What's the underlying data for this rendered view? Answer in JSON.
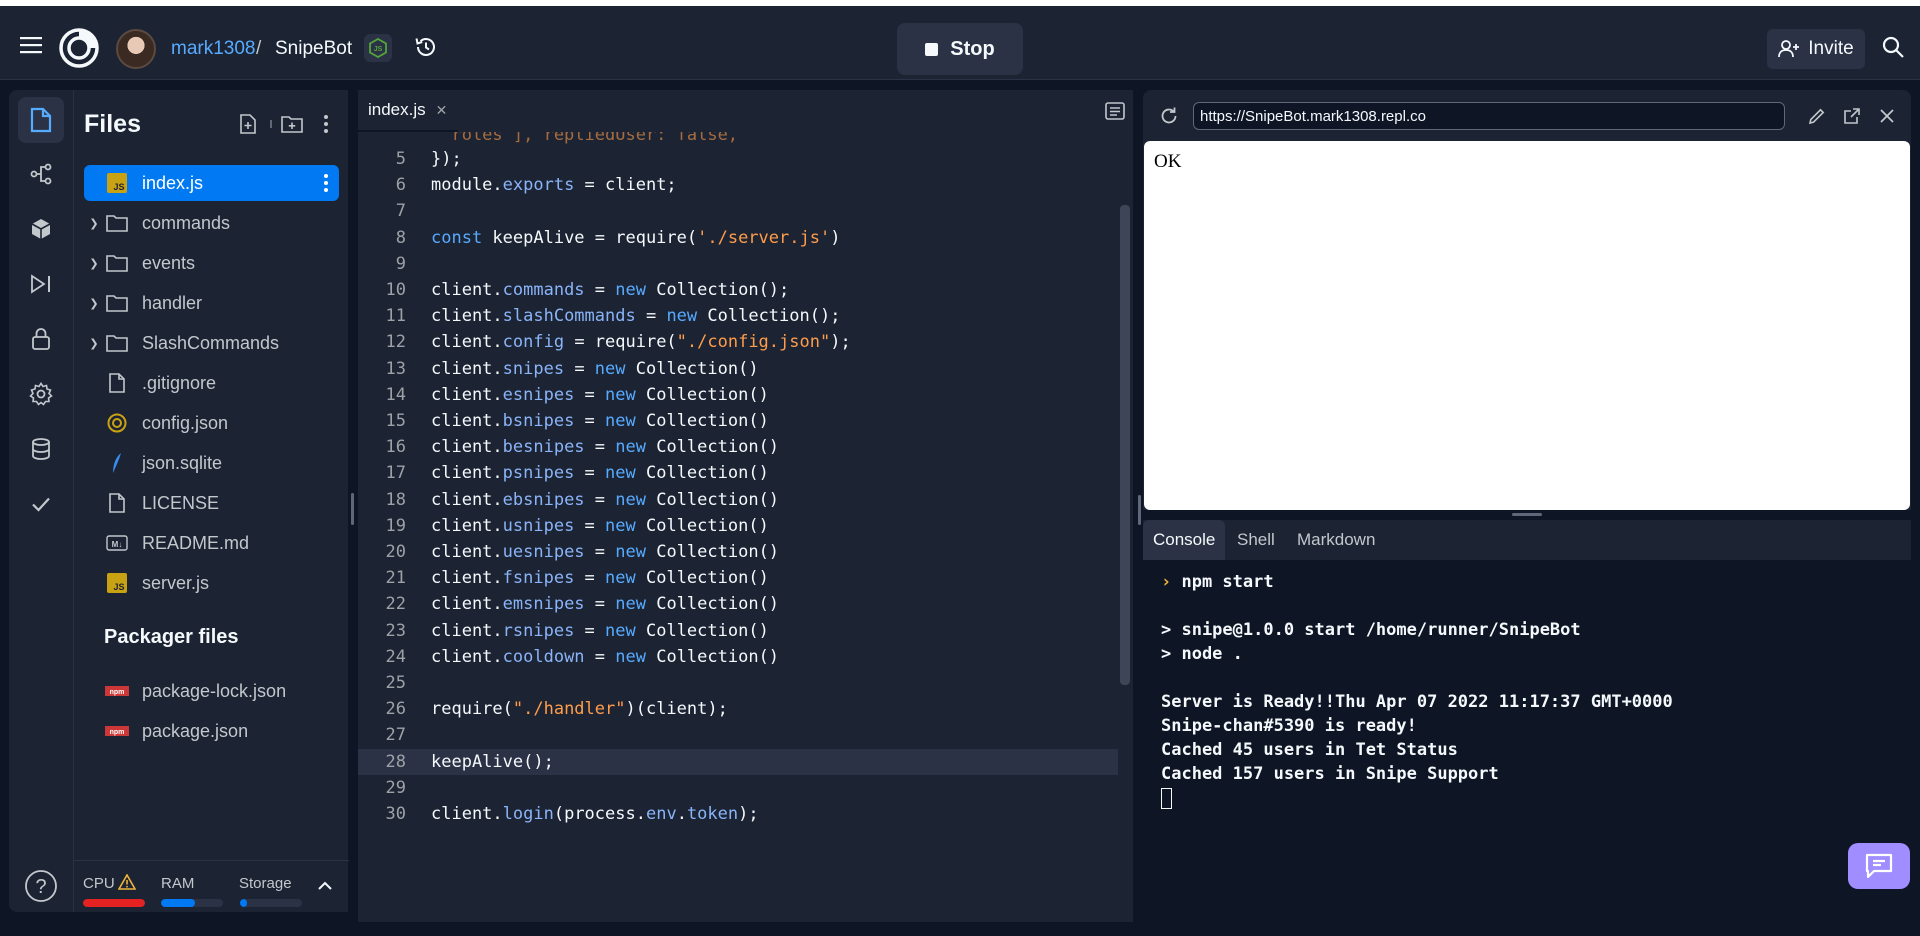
{
  "topbar": {
    "username": "mark1308",
    "separator": "/",
    "repl_name": "SnipeBot",
    "stop_label": "Stop",
    "invite_label": "Invite"
  },
  "files": {
    "title": "Files",
    "items": [
      {
        "label": "index.js",
        "icon": "js-file-icon",
        "type": "file",
        "active": true
      },
      {
        "label": "commands",
        "icon": "folder-icon",
        "type": "folder"
      },
      {
        "label": "events",
        "icon": "folder-icon",
        "type": "folder"
      },
      {
        "label": "handler",
        "icon": "folder-icon",
        "type": "folder"
      },
      {
        "label": "SlashCommands",
        "icon": "folder-icon",
        "type": "folder"
      },
      {
        "label": ".gitignore",
        "icon": "file-icon",
        "type": "file"
      },
      {
        "label": "config.json",
        "icon": "json-file-icon",
        "type": "file"
      },
      {
        "label": "json.sqlite",
        "icon": "sqlite-file-icon",
        "type": "file"
      },
      {
        "label": "LICENSE",
        "icon": "file-icon",
        "type": "file"
      },
      {
        "label": "README.md",
        "icon": "markdown-file-icon",
        "type": "file"
      },
      {
        "label": "server.js",
        "icon": "js-file-icon",
        "type": "file"
      }
    ],
    "packager_title": "Packager files",
    "packager_items": [
      {
        "label": "package-lock.json",
        "icon": "npm-icon"
      },
      {
        "label": "package.json",
        "icon": "npm-icon"
      }
    ]
  },
  "resources": {
    "cpu_label": "CPU",
    "ram_label": "RAM",
    "storage_label": "Storage",
    "cpu_fraction": 1.0,
    "ram_fraction": 0.55,
    "storage_fraction": 0.12,
    "cpu_color": "#e52222",
    "ram_color": "#0079f2",
    "storage_color": "#0079f2"
  },
  "editor": {
    "tab_label": "index.js",
    "partial_top_line": " 'roles'], repliedUser: false,",
    "lines": [
      {
        "n": "5",
        "segs": [
          [
            "",
            "});"
          ]
        ]
      },
      {
        "n": "6",
        "segs": [
          [
            "",
            "module."
          ],
          [
            "prop",
            "exports"
          ],
          [
            "",
            " = client;"
          ]
        ]
      },
      {
        "n": "7",
        "segs": []
      },
      {
        "n": "8",
        "segs": [
          [
            "kw",
            "const"
          ],
          [
            "",
            " keepAlive = require("
          ],
          [
            "str",
            "'./server.js'"
          ],
          [
            "",
            ")"
          ]
        ]
      },
      {
        "n": "9",
        "segs": []
      },
      {
        "n": "10",
        "segs": [
          [
            "",
            "client."
          ],
          [
            "prop",
            "commands"
          ],
          [
            "",
            " = "
          ],
          [
            "kw",
            "new"
          ],
          [
            "",
            " Collection();"
          ]
        ]
      },
      {
        "n": "11",
        "segs": [
          [
            "",
            "client."
          ],
          [
            "prop",
            "slashCommands"
          ],
          [
            "",
            " = "
          ],
          [
            "kw",
            "new"
          ],
          [
            "",
            " Collection();"
          ]
        ]
      },
      {
        "n": "12",
        "segs": [
          [
            "",
            "client."
          ],
          [
            "prop",
            "config"
          ],
          [
            "",
            " = require("
          ],
          [
            "str",
            "\"./config.json\""
          ],
          [
            "",
            ");"
          ]
        ]
      },
      {
        "n": "13",
        "segs": [
          [
            "",
            "client."
          ],
          [
            "prop",
            "snipes"
          ],
          [
            "",
            " = "
          ],
          [
            "kw",
            "new"
          ],
          [
            "",
            " Collection()"
          ]
        ]
      },
      {
        "n": "14",
        "segs": [
          [
            "",
            "client."
          ],
          [
            "prop",
            "esnipes"
          ],
          [
            "",
            " = "
          ],
          [
            "kw",
            "new"
          ],
          [
            "",
            " Collection()"
          ]
        ]
      },
      {
        "n": "15",
        "segs": [
          [
            "",
            "client."
          ],
          [
            "prop",
            "bsnipes"
          ],
          [
            "",
            " = "
          ],
          [
            "kw",
            "new"
          ],
          [
            "",
            " Collection()"
          ]
        ]
      },
      {
        "n": "16",
        "segs": [
          [
            "",
            "client."
          ],
          [
            "prop",
            "besnipes"
          ],
          [
            "",
            " = "
          ],
          [
            "kw",
            "new"
          ],
          [
            "",
            " Collection()"
          ]
        ]
      },
      {
        "n": "17",
        "segs": [
          [
            "",
            "client."
          ],
          [
            "prop",
            "psnipes"
          ],
          [
            "",
            " = "
          ],
          [
            "kw",
            "new"
          ],
          [
            "",
            " Collection()"
          ]
        ]
      },
      {
        "n": "18",
        "segs": [
          [
            "",
            "client."
          ],
          [
            "prop",
            "ebsnipes"
          ],
          [
            "",
            " = "
          ],
          [
            "kw",
            "new"
          ],
          [
            "",
            " Collection()"
          ]
        ]
      },
      {
        "n": "19",
        "segs": [
          [
            "",
            "client."
          ],
          [
            "prop",
            "usnipes"
          ],
          [
            "",
            " = "
          ],
          [
            "kw",
            "new"
          ],
          [
            "",
            " Collection()"
          ]
        ]
      },
      {
        "n": "20",
        "segs": [
          [
            "",
            "client."
          ],
          [
            "prop",
            "uesnipes"
          ],
          [
            "",
            " = "
          ],
          [
            "kw",
            "new"
          ],
          [
            "",
            " Collection()"
          ]
        ]
      },
      {
        "n": "21",
        "segs": [
          [
            "",
            "client."
          ],
          [
            "prop",
            "fsnipes"
          ],
          [
            "",
            " = "
          ],
          [
            "kw",
            "new"
          ],
          [
            "",
            " Collection()"
          ]
        ]
      },
      {
        "n": "22",
        "segs": [
          [
            "",
            "client."
          ],
          [
            "prop",
            "emsnipes"
          ],
          [
            "",
            " = "
          ],
          [
            "kw",
            "new"
          ],
          [
            "",
            " Collection()"
          ]
        ]
      },
      {
        "n": "23",
        "segs": [
          [
            "",
            "client."
          ],
          [
            "prop",
            "rsnipes"
          ],
          [
            "",
            " = "
          ],
          [
            "kw",
            "new"
          ],
          [
            "",
            " Collection()"
          ]
        ]
      },
      {
        "n": "24",
        "segs": [
          [
            "",
            "client."
          ],
          [
            "prop",
            "cooldown"
          ],
          [
            "",
            " = "
          ],
          [
            "kw",
            "new"
          ],
          [
            "",
            " Collection()"
          ]
        ]
      },
      {
        "n": "25",
        "segs": []
      },
      {
        "n": "26",
        "segs": [
          [
            "",
            "require("
          ],
          [
            "str",
            "\"./handler\""
          ],
          [
            "",
            ")(client);"
          ]
        ]
      },
      {
        "n": "27",
        "segs": []
      },
      {
        "n": "28",
        "segs": [
          [
            "",
            "keepAlive();"
          ]
        ],
        "highlight": true
      },
      {
        "n": "29",
        "segs": []
      },
      {
        "n": "30",
        "segs": [
          [
            "",
            "client."
          ],
          [
            "prop",
            "login"
          ],
          [
            "",
            "(process."
          ],
          [
            "prop",
            "env"
          ],
          [
            "",
            "."
          ],
          [
            "prop",
            "token"
          ],
          [
            "",
            ");"
          ]
        ]
      }
    ]
  },
  "webview": {
    "url": "https://SnipeBot.mark1308.repl.co",
    "content": "OK"
  },
  "console": {
    "tabs": [
      "Console",
      "Shell",
      "Markdown"
    ],
    "active_tab": "Console",
    "lines": [
      {
        "text": "npm start",
        "prompt": true
      },
      {
        "text": ""
      },
      {
        "text": "> snipe@1.0.0 start /home/runner/SnipeBot"
      },
      {
        "text": "> node ."
      },
      {
        "text": ""
      },
      {
        "text": "Server is Ready!!Thu Apr 07 2022 11:17:37 GMT+0000"
      },
      {
        "text": "Snipe-chan#5390 is ready!"
      },
      {
        "text": "Cached 45 users in Tet Status"
      },
      {
        "text": "Cached 157 users in Snipe Support"
      }
    ]
  }
}
